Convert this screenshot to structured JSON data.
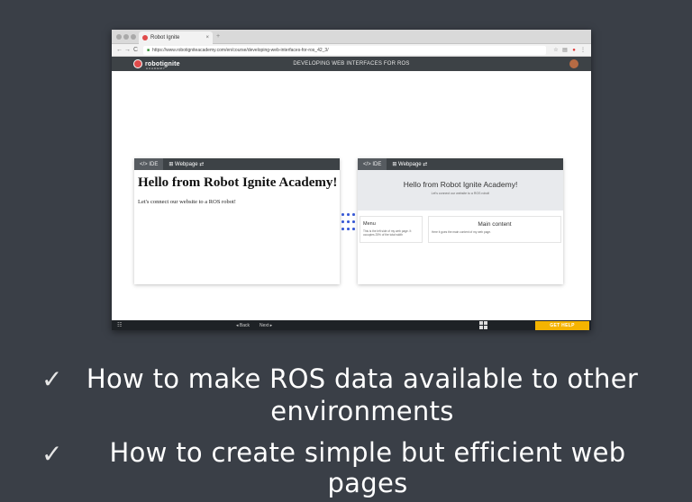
{
  "browser": {
    "tab_title": "Robot Ignite",
    "tab_close": "×",
    "new_tab": "+",
    "url": "https://www.robotigniteacademy.com/en/course/developing-web-interfaces-for-ros_42_3/",
    "nav_back": "←",
    "nav_forward": "→",
    "nav_reload": "C",
    "lock": "🔒"
  },
  "app_header": {
    "logo_text": "robotignite",
    "logo_sub": "ACADEMY",
    "course_title": "DEVELOPING WEB INTERFACES FOR ROS"
  },
  "bottom_bar": {
    "back_label": "◂ Back",
    "next_label": "Next ▸",
    "get_help_label": "GET HELP",
    "menu_icon": "☷"
  },
  "left_panel": {
    "tab_ide": "</> IDE",
    "tab_webpage": "⊞ Webpage ⇄",
    "heading": "Hello from Robot Ignite Academy!",
    "text": "Let's connect our website to a ROS robot!"
  },
  "right_panel": {
    "tab_ide": "</> IDE",
    "tab_webpage": "⊞ Webpage ⇄",
    "hero_title": "Hello from Robot Ignite Academy!",
    "hero_sub": "Let's connect our website to a ROS robot!",
    "menu_title": "Menu",
    "menu_text": "This is the left side of my web page. It occupies 25% of the total width",
    "main_title": "Main content",
    "main_text": "Here it goes the main content of my web page."
  },
  "bullets": {
    "check": "✓",
    "item1_line1": "How to make ROS data available to other",
    "item1_line2": "environments",
    "item2": "How to create simple but efficient web pages"
  },
  "colors": {
    "background": "#3a3f47",
    "accent_help": "#f5b400",
    "header_dark": "#3d4246",
    "dots": "#3a5bd6"
  }
}
